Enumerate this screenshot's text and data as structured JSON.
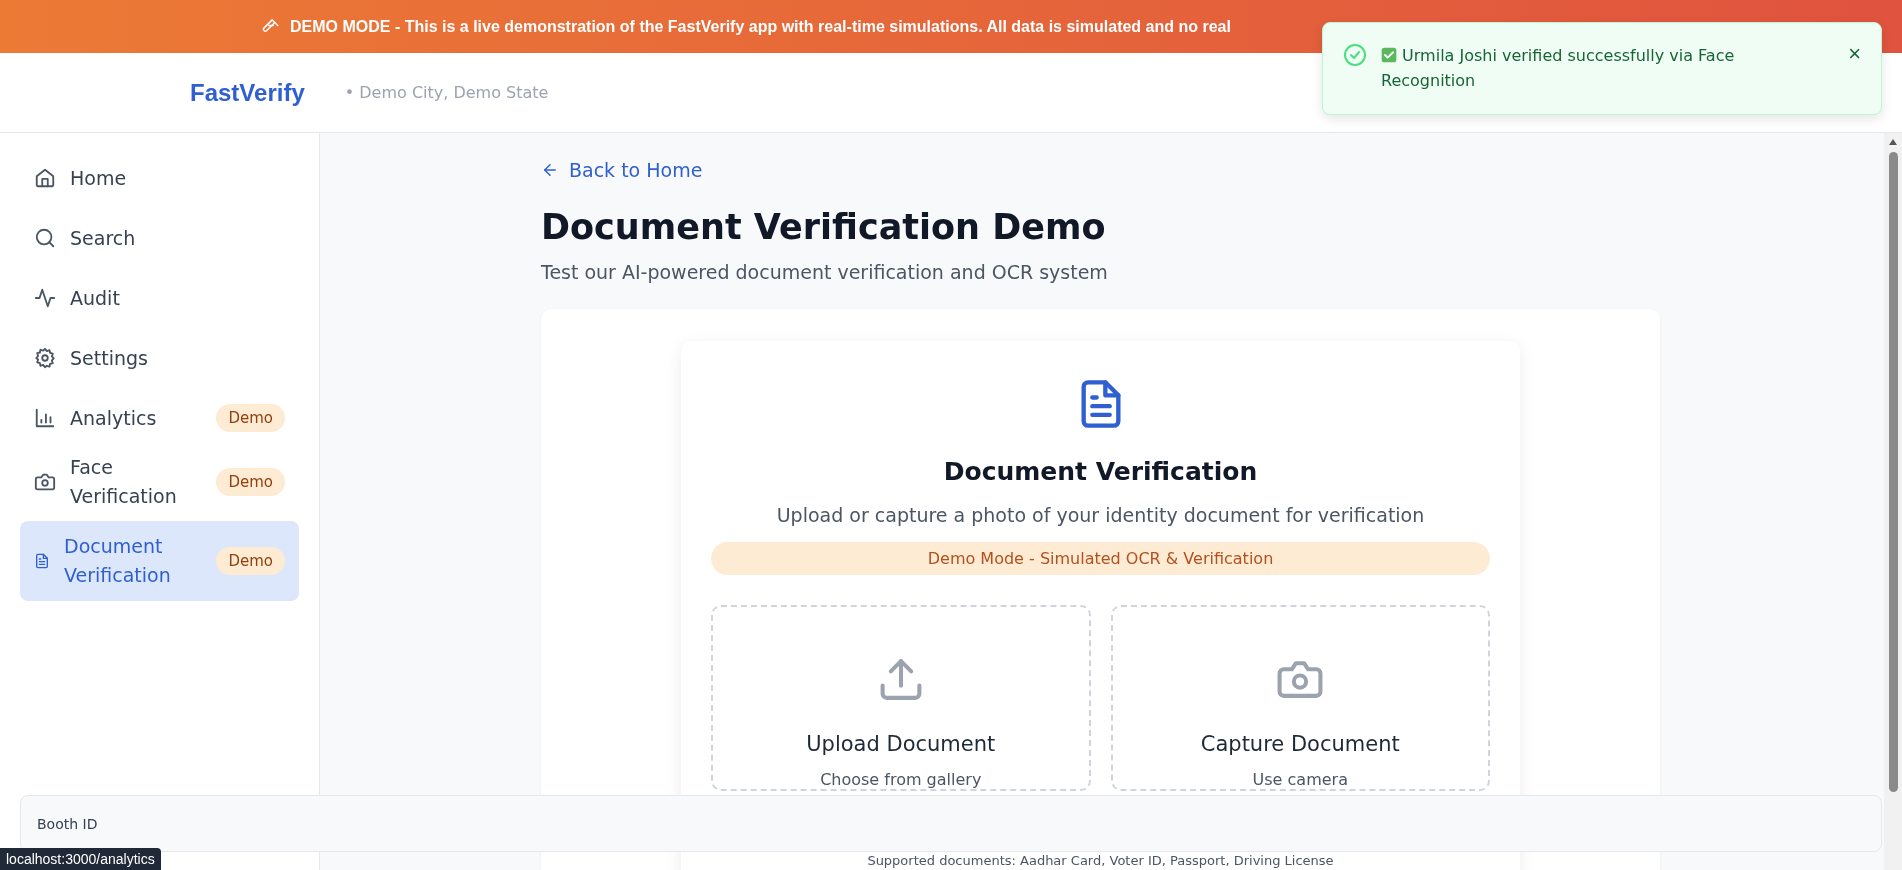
{
  "banner": {
    "label": "DEMO MODE -",
    "text": "This is a live demonstration of the FastVerify app with real-time simulations. All data is simulated and no real"
  },
  "header": {
    "brand": "FastVerify",
    "location": "• Demo City, Demo State"
  },
  "toast": {
    "message": "Urmila Joshi verified successfully via Face Recognition",
    "close": "×"
  },
  "sidebar": {
    "items": [
      {
        "label": "Home",
        "kind": "home",
        "selected": false
      },
      {
        "label": "Search",
        "kind": "search",
        "selected": false
      },
      {
        "label": "Audit",
        "kind": "activity",
        "selected": false
      },
      {
        "label": "Settings",
        "kind": "settings",
        "selected": false
      },
      {
        "label": "Analytics",
        "kind": "chart",
        "badge": "Demo",
        "selected": false
      },
      {
        "label": "Face Verification",
        "kind": "camera",
        "badge": "Demo",
        "selected": false
      },
      {
        "label": "Document Verification",
        "kind": "doc",
        "badge": "Demo",
        "selected": true
      }
    ]
  },
  "main": {
    "back_link": "Back to Home",
    "title": "Document Verification Demo",
    "subtitle": "Test our AI-powered document verification and OCR system",
    "card": {
      "title": "Document Verification",
      "description": "Upload or capture a photo of your identity document for verification",
      "demo_notice": "Demo Mode - Simulated OCR & Verification",
      "options": [
        {
          "kind": "upload",
          "title": "Upload Document",
          "subtitle": "Choose from gallery"
        },
        {
          "kind": "camera",
          "title": "Capture Document",
          "subtitle": "Use camera"
        }
      ],
      "supported": "Supported documents: Aadhar Card, Voter ID, Passport, Driving License"
    }
  },
  "booth_bar": {
    "label": "Booth ID"
  },
  "status_url": "localhost:3000/analytics"
}
